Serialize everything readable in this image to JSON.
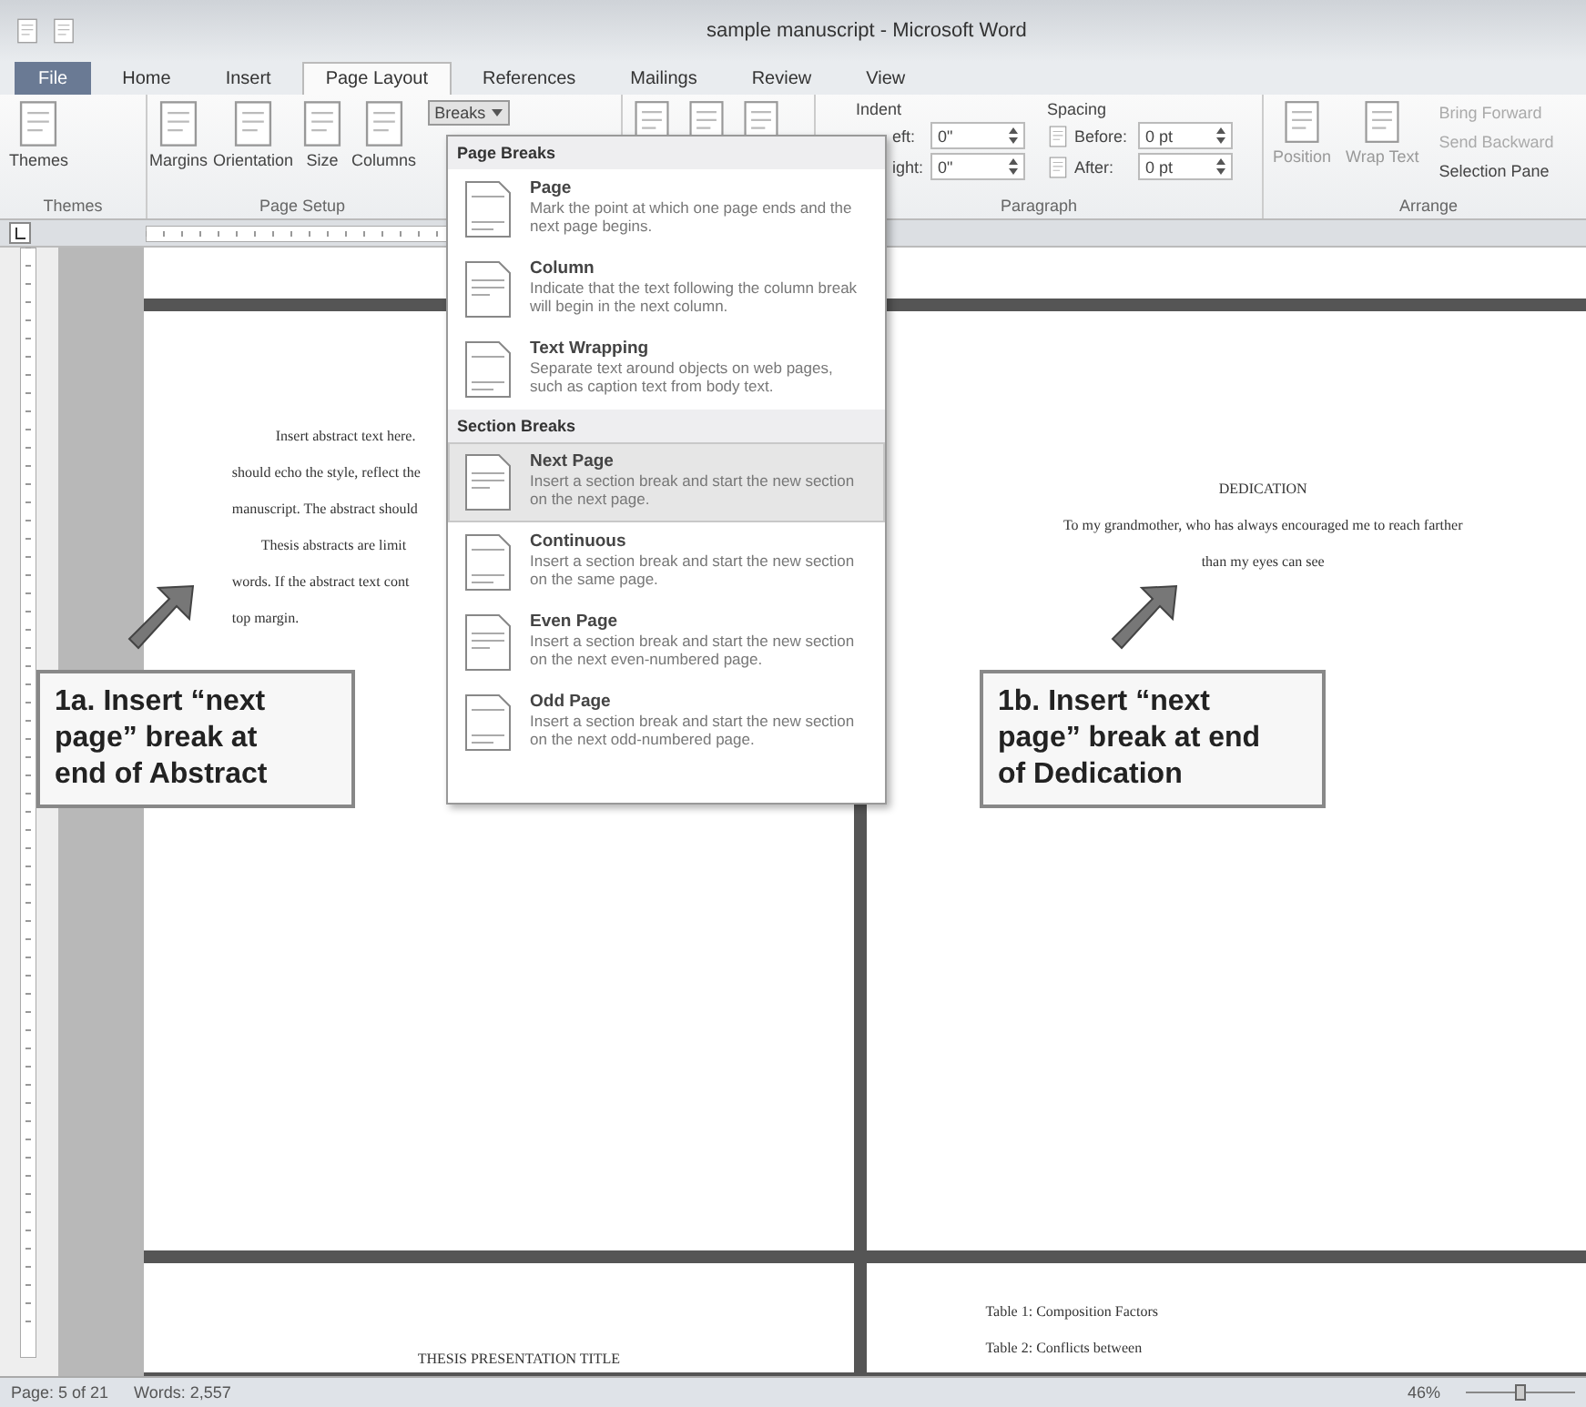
{
  "window": {
    "title": "sample manuscript - Microsoft Word"
  },
  "tabs": [
    {
      "label": "File",
      "kind": "file",
      "selected": false
    },
    {
      "label": "Home",
      "kind": "tab",
      "selected": false
    },
    {
      "label": "Insert",
      "kind": "tab",
      "selected": false
    },
    {
      "label": "Page Layout",
      "kind": "tab",
      "selected": true
    },
    {
      "label": "References",
      "kind": "tab",
      "selected": false
    },
    {
      "label": "Mailings",
      "kind": "tab",
      "selected": false
    },
    {
      "label": "Review",
      "kind": "tab",
      "selected": false
    },
    {
      "label": "View",
      "kind": "tab",
      "selected": false
    }
  ],
  "themes_group": {
    "button": "Themes",
    "label": "Themes"
  },
  "page_setup": {
    "label": "Page Setup",
    "buttons": [
      "Margins",
      "Orientation",
      "Size",
      "Columns"
    ],
    "breaks": {
      "label": "Breaks",
      "expanded": true
    }
  },
  "paragraph": {
    "label": "Paragraph",
    "indent": {
      "heading": "Indent",
      "fields": [
        {
          "label": "eft:",
          "value": "0\""
        },
        {
          "label": "ight:",
          "value": "0\""
        }
      ]
    },
    "spacing": {
      "heading": "Spacing",
      "fields": [
        {
          "label": "Before:",
          "value": "0 pt"
        },
        {
          "label": "After:",
          "value": "0 pt"
        }
      ]
    }
  },
  "arrange": {
    "label": "Arrange",
    "large_buttons": [
      "Position",
      "Wrap Text"
    ],
    "small_buttons": [
      {
        "label": "Bring Forward",
        "disabled": true
      },
      {
        "label": "Send Backward",
        "disabled": true
      },
      {
        "label": "Selection Pane",
        "disabled": false
      }
    ]
  },
  "breaks_menu": {
    "sections": [
      {
        "heading": "Page Breaks",
        "items": [
          {
            "title": "Page",
            "description": "Mark the point at which one page ends and the next page begins.",
            "selected": false
          },
          {
            "title": "Column",
            "description": "Indicate that the text following the column break will begin in the next column.",
            "selected": false
          },
          {
            "title": "Text Wrapping",
            "description": "Separate text around objects on web pages, such as caption text from body text.",
            "selected": false
          }
        ]
      },
      {
        "heading": "Section Breaks",
        "items": [
          {
            "title": "Next Page",
            "description": "Insert a section break and start the new section on the next page.",
            "selected": true
          },
          {
            "title": "Continuous",
            "description": "Insert a section break and start the new section on the same page.",
            "selected": false
          },
          {
            "title": "Even Page",
            "description": "Insert a section break and start the new section on the next even-numbered page.",
            "selected": false
          },
          {
            "title": "Odd Page",
            "description": "Insert a section break and start the new section on the next odd-numbered page.",
            "selected": false
          }
        ]
      }
    ]
  },
  "left_page": {
    "lines": [
      {
        "text": "Insert abstract text here.",
        "kind": "indented"
      },
      {
        "text": "should echo the style, reflect the",
        "kind": "plain"
      },
      {
        "text": "manuscript. The abstract should",
        "kind": "plain"
      },
      {
        "text": "Thesis abstracts are limit",
        "kind": "indented"
      },
      {
        "text": "words.   If the abstract text cont",
        "kind": "plain"
      },
      {
        "text": "top margin.",
        "kind": "plain"
      }
    ]
  },
  "right_page": {
    "heading": "DEDICATION",
    "lines": [
      "To my grandmother, who has always encouraged me to reach farther",
      "than my eyes can see"
    ]
  },
  "next_pages": {
    "left": [
      "THESIS PRESENTATION TITLE"
    ],
    "right": [
      "Table 1:  Composition Factors",
      "Table 2:  Conflicts between"
    ]
  },
  "callouts": [
    {
      "lines": [
        "1a. Insert “next",
        "page” break at",
        "end of Abstract"
      ]
    },
    {
      "lines": [
        "1b.  Insert “next",
        "page” break at end",
        "of Dedication"
      ]
    }
  ],
  "status_bar": {
    "page": "Page: 5 of 21",
    "words": "Words: 2,557",
    "zoom": "46%",
    "zoom_slider": {
      "level": 0.5
    }
  }
}
